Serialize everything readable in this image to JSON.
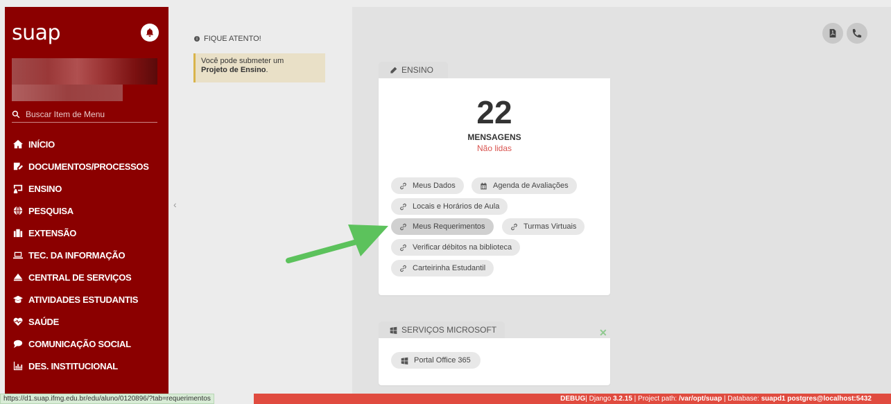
{
  "sidebar": {
    "logo": "suap",
    "search_placeholder": "Buscar Item de Menu",
    "items": [
      {
        "label": "INÍCIO",
        "icon": "home-icon"
      },
      {
        "label": "DOCUMENTOS/PROCESSOS",
        "icon": "document-edit-icon"
      },
      {
        "label": "ENSINO",
        "icon": "chalkboard-icon"
      },
      {
        "label": "PESQUISA",
        "icon": "globe-icon"
      },
      {
        "label": "EXTENSÃO",
        "icon": "building-icon"
      },
      {
        "label": "TEC. DA INFORMAÇÃO",
        "icon": "laptop-icon"
      },
      {
        "label": "CENTRAL DE SERVIÇOS",
        "icon": "eject-icon"
      },
      {
        "label": "ATIVIDADES ESTUDANTIS",
        "icon": "graduation-cap-icon"
      },
      {
        "label": "SAÚDE",
        "icon": "heartbeat-icon"
      },
      {
        "label": "COMUNICAÇÃO SOCIAL",
        "icon": "comment-icon"
      },
      {
        "label": "DES. INSTITUCIONAL",
        "icon": "chart-icon"
      }
    ]
  },
  "attention": {
    "title": "FIQUE ATENTO!",
    "notice_text": "Você pode submeter um",
    "notice_link": "Projeto de Ensino",
    "notice_end": "."
  },
  "ensino": {
    "tab_label": "ENSINO",
    "count": "22",
    "count_label": "MENSAGENS",
    "count_sub": "Não lidas",
    "links": [
      "Meus Dados",
      "Agenda de Avaliações",
      "Locais e Horários de Aula",
      "Meus Requerimentos",
      "Turmas Virtuais",
      "Verificar débitos na biblioteca",
      "Carteirinha Estudantil"
    ]
  },
  "microsoft": {
    "tab_label": "SERVIÇOS MICROSOFT",
    "link": "Portal Office 365",
    "close": "✕"
  },
  "status": {
    "url": "https://d1.suap.ifmg.edu.br/edu/aluno/0120896/?tab=requerimentos",
    "debug_label": "DEBUG",
    "django_prefix": "| Django ",
    "django_version": "3.2.15",
    "path_prefix": " | Project path: ",
    "path": "/var/opt/suap",
    "db_prefix": " | Database: ",
    "db": "suapd1 postgres@localhost:5432"
  },
  "colors": {
    "sidebar": "#8b0000",
    "debug_bar": "#e04b3f",
    "notice_border": "#d9b44a",
    "unread": "#d9534f",
    "arrow": "#5cc25c"
  }
}
